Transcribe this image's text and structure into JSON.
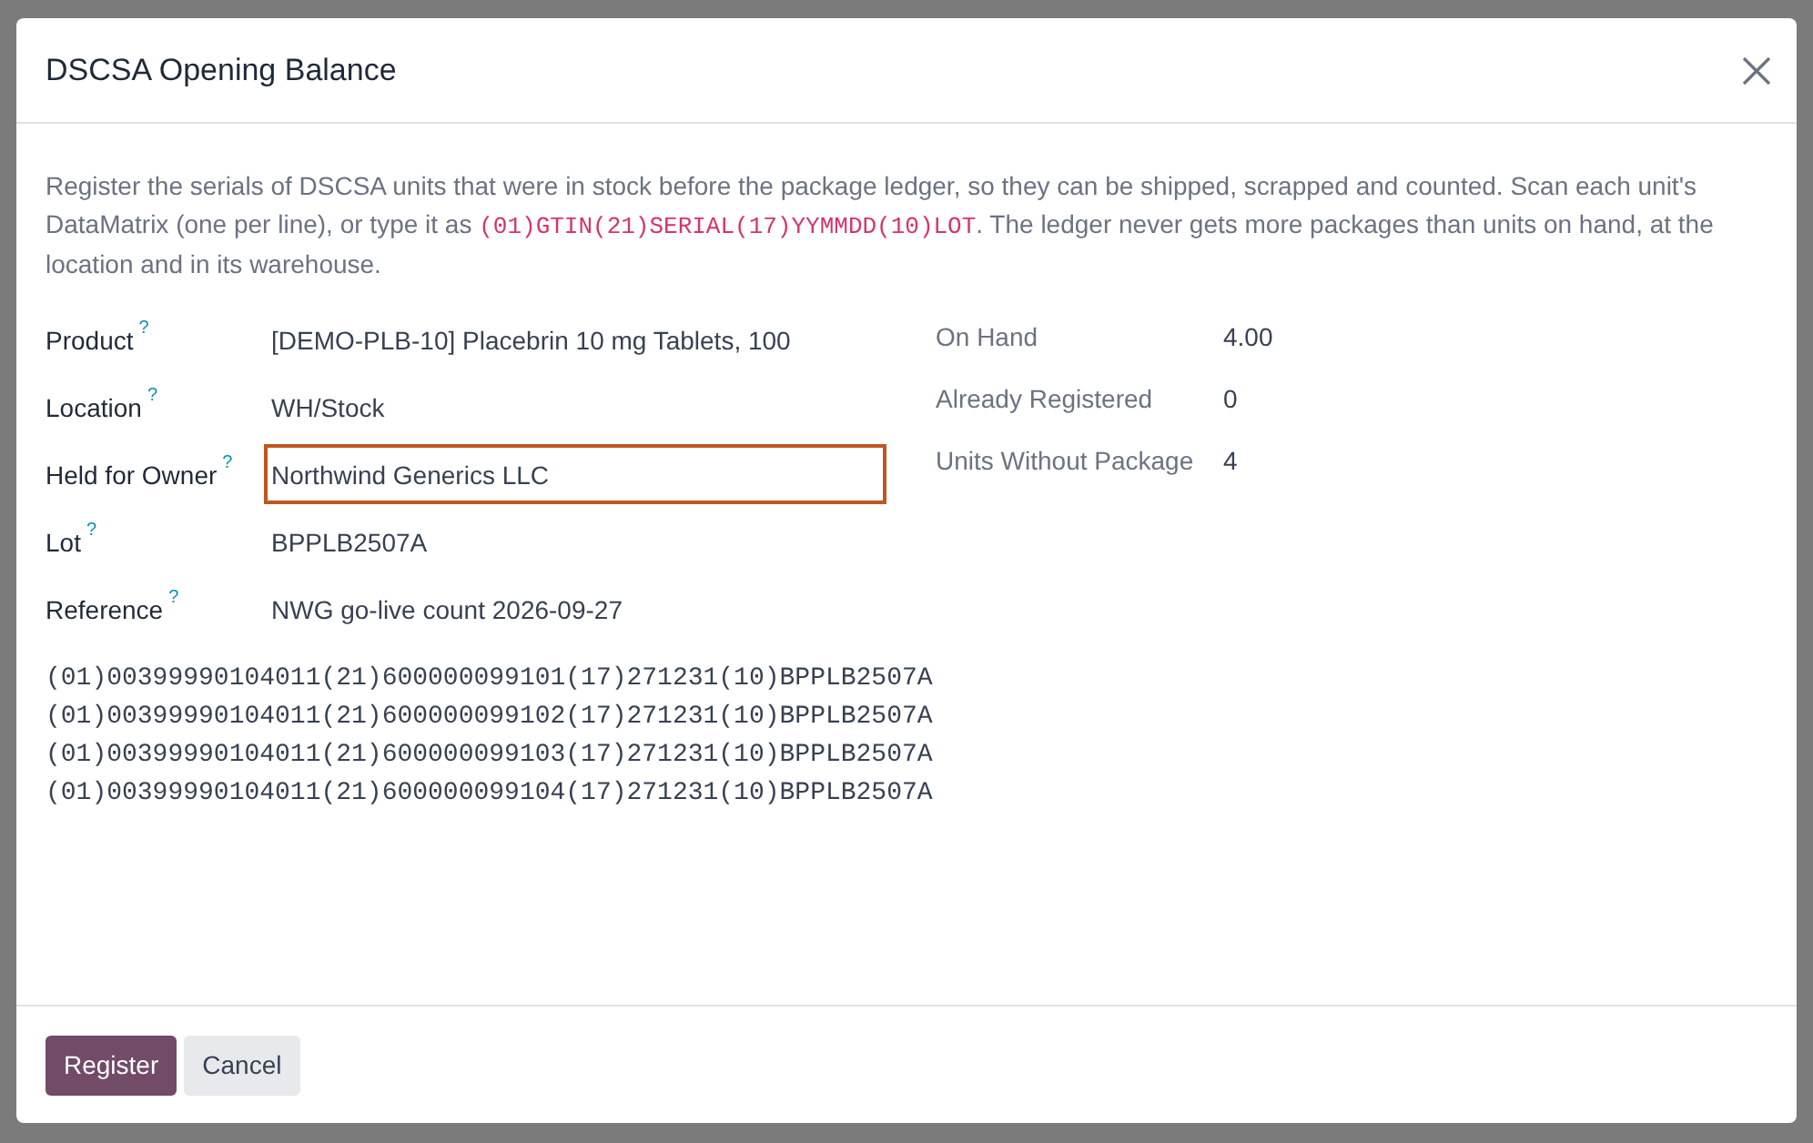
{
  "dialog": {
    "title": "DSCSA Opening Balance"
  },
  "description": [
    {
      "kind": "text",
      "text": "Register the serials of DSCSA units that were in stock before the package ledger, so they can be shipped, scrapped and counted. Scan each unit's DataMatrix (one per line), or type it as "
    },
    {
      "kind": "code",
      "text": "(01)GTIN(21)SERIAL(17)YYMMDD(10)LOT"
    },
    {
      "kind": "text",
      "text": ". The ledger never gets more packages than units on hand, at the location and in its warehouse."
    }
  ],
  "fields": [
    {
      "label": "Product",
      "help": "?",
      "value": "[DEMO-PLB-10] Placebrin 10 mg Tablets, 100",
      "focused": false
    },
    {
      "label": "Location",
      "help": "?",
      "value": "WH/Stock",
      "focused": false
    },
    {
      "label": "Held for Owner",
      "help": "?",
      "value": "Northwind Generics LLC",
      "focused": true
    },
    {
      "label": "Lot",
      "help": "?",
      "value": "BPPLB2507A",
      "focused": false
    },
    {
      "label": "Reference",
      "help": "?",
      "value": "NWG go-live count 2026-09-27",
      "focused": false
    }
  ],
  "stats": [
    {
      "label": "On Hand",
      "value": "4.00"
    },
    {
      "label": "Already Registered",
      "value": "0"
    },
    {
      "label": "Units Without Package",
      "value": "4"
    }
  ],
  "serials": [
    "(01)00399990104011(21)600000099101(17)271231(10)BPPLB2507A",
    "(01)00399990104011(21)600000099102(17)271231(10)BPPLB2507A",
    "(01)00399990104011(21)600000099103(17)271231(10)BPPLB2507A",
    "(01)00399990104011(21)600000099104(17)271231(10)BPPLB2507A"
  ],
  "buttons": [
    {
      "label": "Register",
      "kind": "primary"
    },
    {
      "label": "Cancel",
      "kind": "secondary"
    }
  ]
}
